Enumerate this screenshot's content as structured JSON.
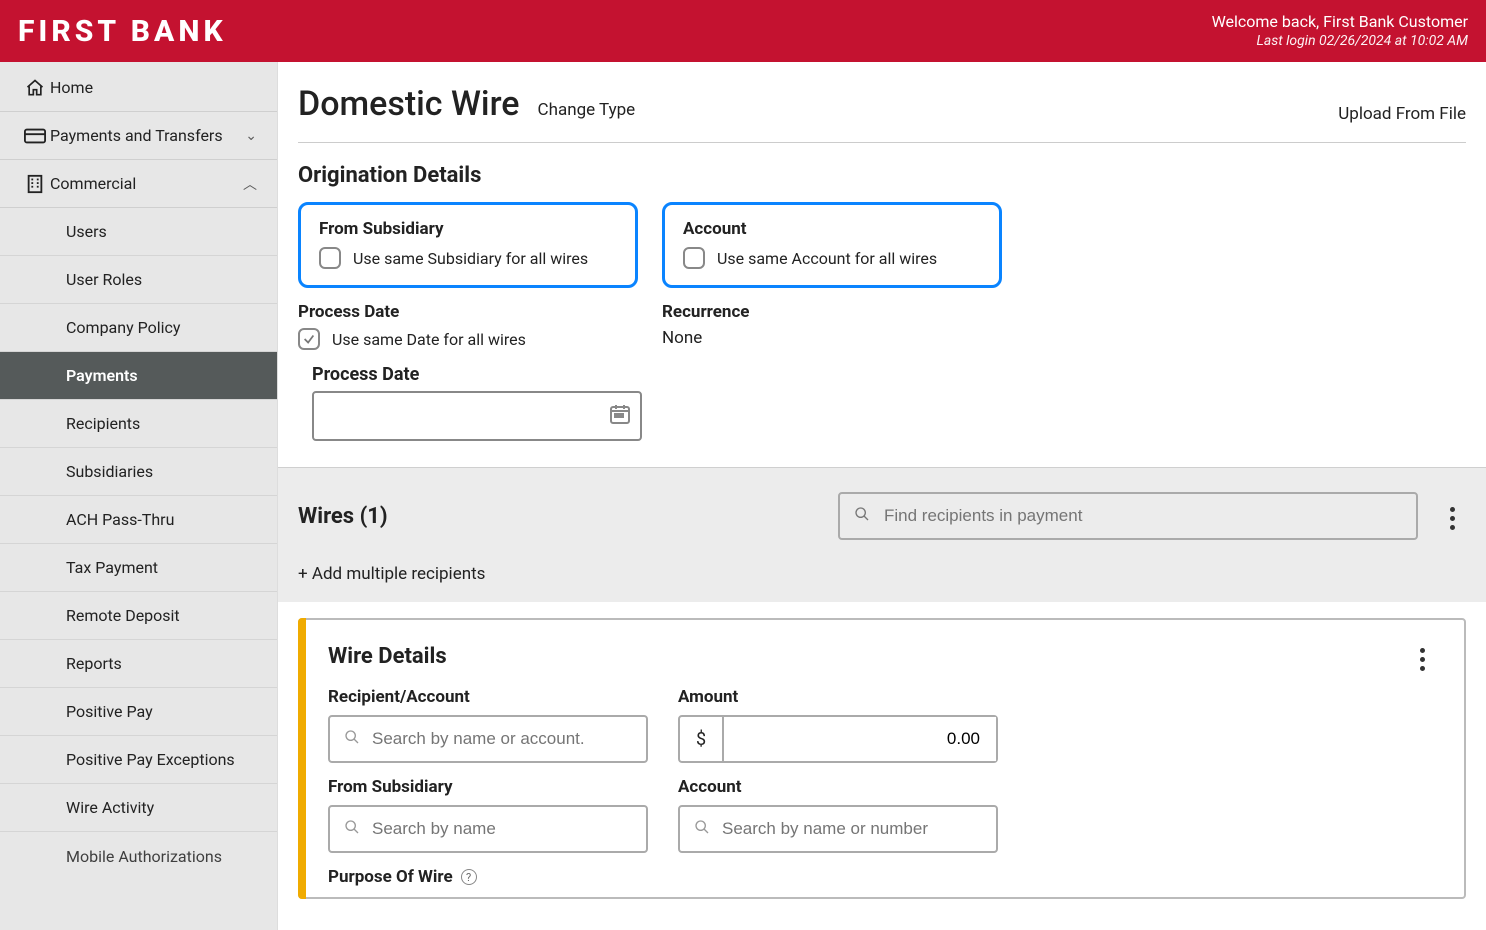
{
  "banner": {
    "brand": "FIRST BANK",
    "welcome": "Welcome back, First Bank Customer",
    "last_login": "Last login 02/26/2024 at 10:02 AM"
  },
  "sidebar": {
    "home": "Home",
    "payments_transfers": "Payments and Transfers",
    "commercial": "Commercial",
    "sub": {
      "users": "Users",
      "user_roles": "User Roles",
      "company_policy": "Company Policy",
      "payments": "Payments",
      "recipients": "Recipients",
      "subsidiaries": "Subsidiaries",
      "ach_passthru": "ACH Pass-Thru",
      "tax_payment": "Tax Payment",
      "remote_deposit": "Remote Deposit",
      "reports": "Reports",
      "positive_pay": "Positive Pay",
      "positive_pay_exceptions": "Positive Pay Exceptions",
      "wire_activity": "Wire Activity",
      "mobile_auth": "Mobile Authorizations"
    }
  },
  "header": {
    "title": "Domestic Wire",
    "change_type": "Change Type",
    "upload": "Upload From File"
  },
  "orig": {
    "title": "Origination Details",
    "from_subsidiary_label": "From Subsidiary",
    "from_subsidiary_chk_text": "Use same Subsidiary for all wires",
    "account_label": "Account",
    "account_chk_text": "Use same Account for all wires",
    "process_date_label": "Process Date",
    "process_date_chk_text": "Use same Date for all wires",
    "recurrence_label": "Recurrence",
    "recurrence_value": "None",
    "process_date_input_label": "Process Date"
  },
  "wires_band": {
    "title": "Wires (1)",
    "search_placeholder": "Find recipients in payment",
    "add_multiple": "+ Add multiple recipients"
  },
  "wire_detail": {
    "title": "Wire Details",
    "recipient_label": "Recipient/Account",
    "recipient_placeholder": "Search by name or account.",
    "amount_label": "Amount",
    "amount_prefix": "$",
    "amount_value": "0.00",
    "from_sub_label": "From Subsidiary",
    "from_sub_placeholder": "Search by name",
    "account_label": "Account",
    "account_placeholder": "Search by name or number",
    "purpose_label": "Purpose Of Wire"
  }
}
